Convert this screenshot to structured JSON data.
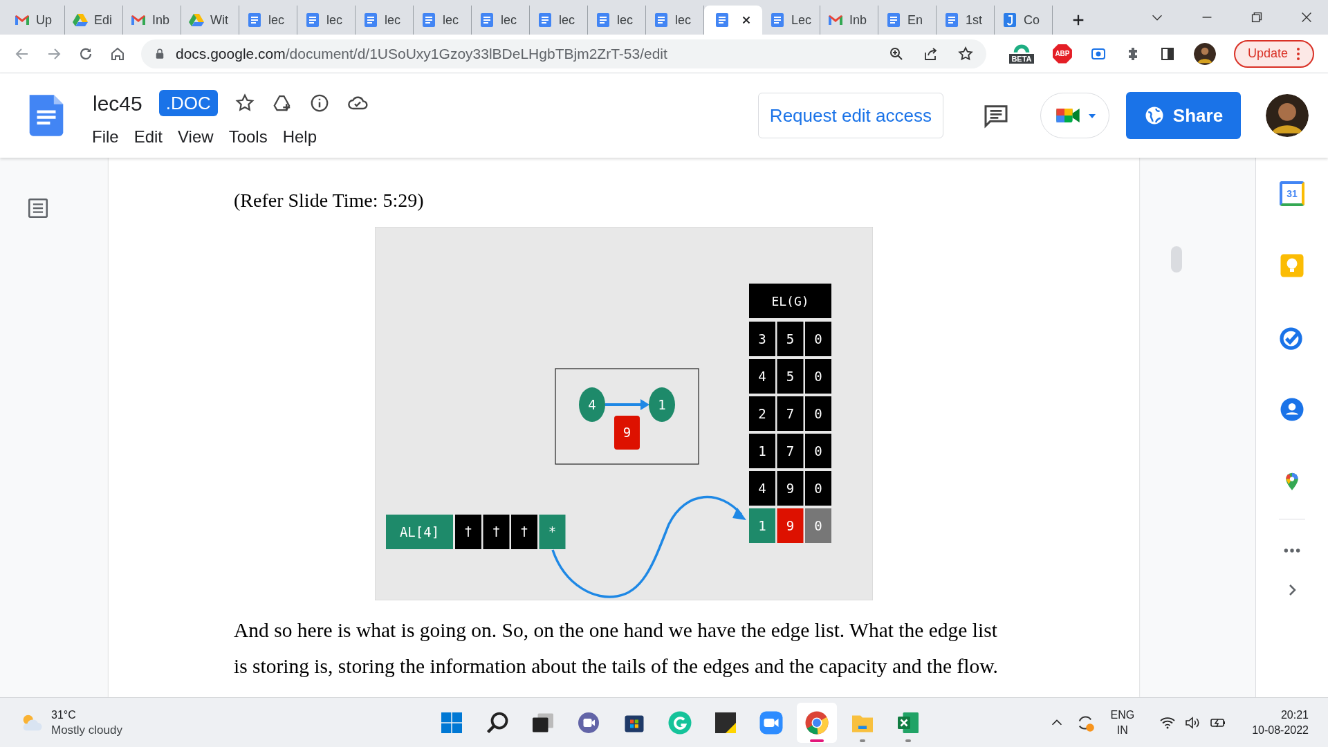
{
  "browser": {
    "tabs": [
      {
        "kind": "mail",
        "label": "Up",
        "selected": false
      },
      {
        "kind": "drive",
        "label": "Edi",
        "selected": false
      },
      {
        "kind": "mail",
        "label": "Inb",
        "selected": false
      },
      {
        "kind": "drive",
        "label": "Wit",
        "selected": false
      },
      {
        "kind": "doc",
        "label": "lec",
        "selected": false
      },
      {
        "kind": "doc",
        "label": "lec",
        "selected": false
      },
      {
        "kind": "doc",
        "label": "lec",
        "selected": false
      },
      {
        "kind": "doc",
        "label": "lec",
        "selected": false
      },
      {
        "kind": "doc",
        "label": "lec",
        "selected": false
      },
      {
        "kind": "doc",
        "label": "lec",
        "selected": false
      },
      {
        "kind": "doc",
        "label": "lec",
        "selected": false
      },
      {
        "kind": "doc",
        "label": "lec",
        "selected": false
      },
      {
        "kind": "doc",
        "selected": true
      },
      {
        "kind": "doc",
        "label": "Lec",
        "selected": false
      },
      {
        "kind": "mail",
        "label": "Inb",
        "selected": false
      },
      {
        "kind": "doc",
        "label": "En",
        "selected": false
      },
      {
        "kind": "doc",
        "label": "1st",
        "selected": false
      },
      {
        "kind": "j",
        "label": "Co",
        "selected": false
      }
    ],
    "url_host": "docs.google.com",
    "url_path": "/document/d/1USoUxy1Gzoy33lBDeLHgbTBjm2ZrT-53/edit",
    "extension_badge": "BETA",
    "adblock": "ABP",
    "update_button": "Update"
  },
  "doc": {
    "title": "lec45",
    "badge": ".DOC",
    "menu": [
      "File",
      "Edit",
      "View",
      "Tools",
      "Help"
    ],
    "request_button": "Request edit access",
    "share_button": "Share"
  },
  "content": {
    "caption": "(Refer Slide Time: 5:29)",
    "slide": {
      "graph": {
        "from": "4",
        "to": "1",
        "weight": "9"
      },
      "adjacency": {
        "label": "AL[4]",
        "cells": [
          {
            "text": "†",
            "highlighted": false
          },
          {
            "text": "†",
            "highlighted": false
          },
          {
            "text": "†",
            "highlighted": false
          },
          {
            "text": "*",
            "highlighted": true
          }
        ]
      },
      "edge_list": {
        "header": "EL(G)",
        "rows": [
          [
            {
              "text": "3"
            },
            {
              "text": "5"
            },
            {
              "text": "0"
            }
          ],
          [
            {
              "text": "4"
            },
            {
              "text": "5"
            },
            {
              "text": "0"
            }
          ],
          [
            {
              "text": "2"
            },
            {
              "text": "7"
            },
            {
              "text": "0"
            }
          ],
          [
            {
              "text": "1"
            },
            {
              "text": "7"
            },
            {
              "text": "0"
            }
          ],
          [
            {
              "text": "4"
            },
            {
              "text": "9"
            },
            {
              "text": "0"
            }
          ],
          [
            {
              "text": "1",
              "color": "#1e8a6a"
            },
            {
              "text": "9",
              "color": "#dd1100"
            },
            {
              "text": "0",
              "color": "#777777"
            }
          ]
        ]
      }
    },
    "paragraph": [
      "And so here is what is going on. So, on the one hand we have the edge list. What the edge list",
      "is storing is, storing the information about the tails of the edges and the capacity and the flow."
    ]
  },
  "side_panel": {
    "calendar_day": "31"
  },
  "taskbar": {
    "temperature": "31°C",
    "weather": "Mostly cloudy",
    "apps": [
      {
        "kind": "start",
        "selected": false,
        "running": false
      },
      {
        "kind": "search",
        "selected": false,
        "running": false
      },
      {
        "kind": "taskview",
        "selected": false,
        "running": false
      },
      {
        "kind": "chat",
        "selected": false,
        "running": false
      },
      {
        "kind": "store",
        "selected": false,
        "running": false
      },
      {
        "kind": "grammarly",
        "selected": false,
        "running": false
      },
      {
        "kind": "notes",
        "selected": false,
        "running": false
      },
      {
        "kind": "zoom",
        "selected": false,
        "running": false
      },
      {
        "kind": "chrome",
        "selected": true,
        "running": true
      },
      {
        "kind": "folder",
        "selected": false,
        "running": true
      },
      {
        "kind": "excel",
        "selected": false,
        "running": true
      }
    ],
    "language": "ENG",
    "region": "IN",
    "time": "20:21",
    "date": "10-08-2022"
  }
}
